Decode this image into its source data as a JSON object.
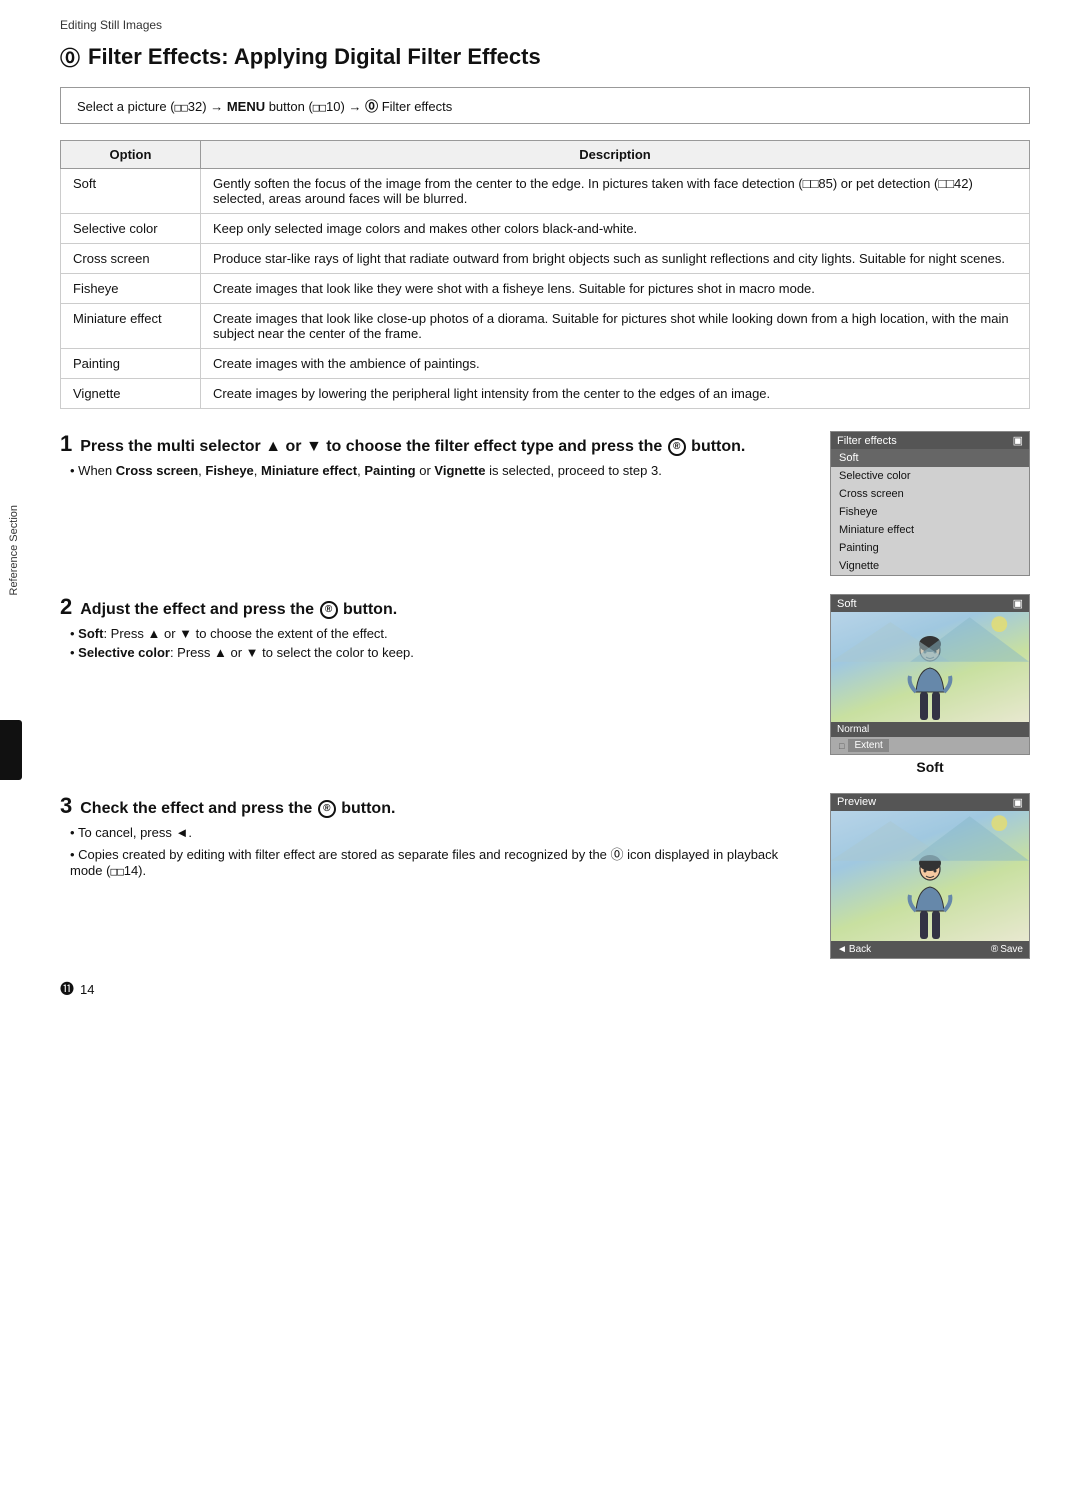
{
  "breadcrumb": "Editing Still Images",
  "page_title": "Filter Effects: Applying Digital Filter Effects",
  "title_icon": "⓪",
  "instruction": {
    "text": "Select a picture (□□32) → MENU button (□□10) → ⓪ Filter effects"
  },
  "table": {
    "col_option": "Option",
    "col_description": "Description",
    "rows": [
      {
        "option": "Soft",
        "description": "Gently soften the focus of the image from the center to the edge. In pictures taken with face detection (□□85) or pet detection (□□42) selected, areas around faces will be blurred."
      },
      {
        "option": "Selective color",
        "description": "Keep only selected image colors and makes other colors black-and-white."
      },
      {
        "option": "Cross screen",
        "description": "Produce star-like rays of light that radiate outward from bright objects such as sunlight reflections and city lights. Suitable for night scenes."
      },
      {
        "option": "Fisheye",
        "description": "Create images that look like they were shot with a fisheye lens. Suitable for pictures shot in macro mode."
      },
      {
        "option": "Miniature effect",
        "description": "Create images that look like close-up photos of a diorama. Suitable for pictures shot while looking down from a high location, with the main subject near the center of the frame."
      },
      {
        "option": "Painting",
        "description": "Create images with the ambience of paintings."
      },
      {
        "option": "Vignette",
        "description": "Create images by lowering the peripheral light intensity from the center to the edges of an image."
      }
    ]
  },
  "step1": {
    "number": "1",
    "heading": "Press the multi selector ▲ or ▼ to choose the filter effect type and press the ® button.",
    "bullet": "When Cross screen, Fisheye, Miniature effect, Painting or Vignette is selected, proceed to step 3.",
    "screen": {
      "title": "Filter effects",
      "items": [
        "Soft",
        "Selective color",
        "Cross screen",
        "Fisheye",
        "Miniature effect",
        "Painting",
        "Vignette"
      ],
      "selected": "Soft"
    }
  },
  "step2": {
    "number": "2",
    "heading": "Adjust the effect and press the ® button.",
    "bullets": [
      {
        "label": "Soft",
        "text": ": Press ▲ or ▼ to choose the extent of the effect."
      },
      {
        "label": "Selective color",
        "text": ": Press ▲ or ▼ to select the color to keep."
      }
    ],
    "screen": {
      "title": "Soft",
      "status": "Normal",
      "extent_label": "Extent"
    },
    "soft_label": "Soft"
  },
  "step3": {
    "number": "3",
    "heading": "Check the effect and press the ® button.",
    "bullets": [
      {
        "text": "To cancel, press ◄."
      },
      {
        "text": "Copies created by editing with filter effect are stored as separate files and recognized by the ⓪ icon displayed in playback mode (□□14)."
      }
    ],
    "screen": {
      "title": "Preview",
      "back_label": "Back",
      "save_label": "Save"
    }
  },
  "footer": {
    "icon": "⓫",
    "page_number": "14"
  },
  "sidebar_label": "Reference Section"
}
